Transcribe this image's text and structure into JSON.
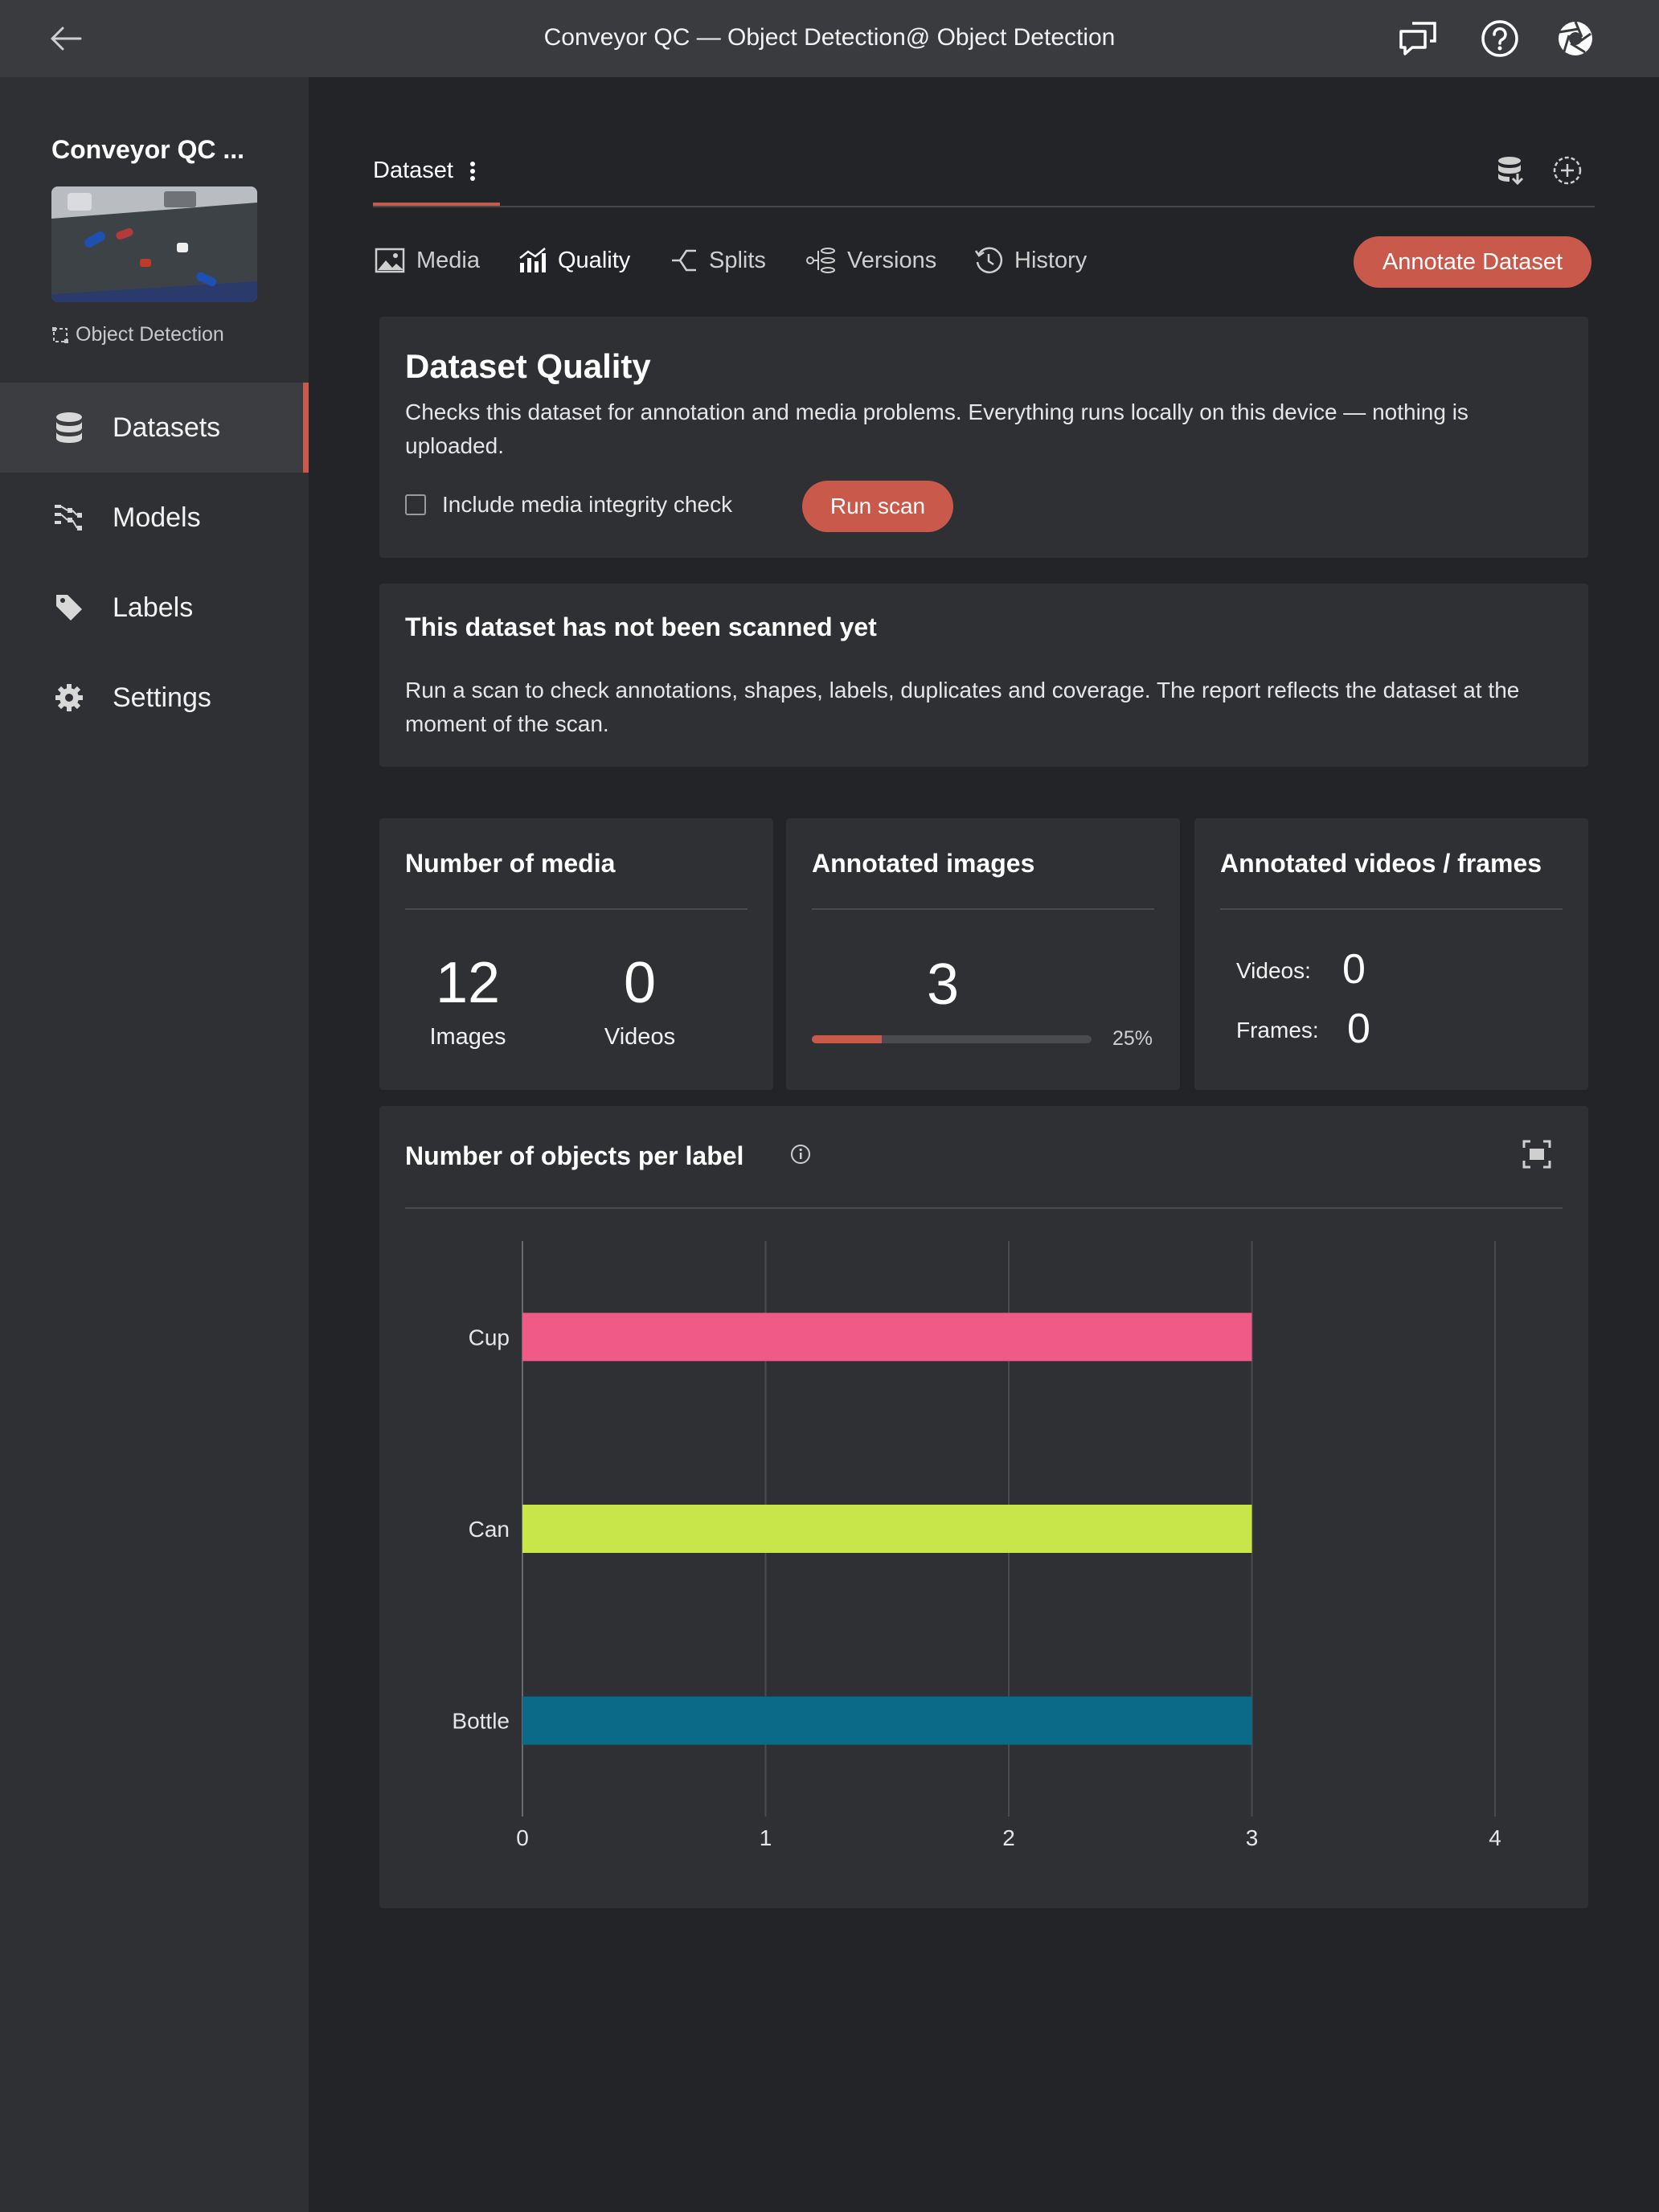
{
  "topbar": {
    "title": "Conveyor QC — Object Detection@ Object Detection",
    "icons": [
      "back-arrow-icon",
      "chat-icon",
      "help-icon",
      "aperture-icon"
    ]
  },
  "sidebar": {
    "project_name": "Conveyor QC ...",
    "task_type": "Object Detection",
    "items": [
      {
        "label": "Datasets",
        "icon": "database-icon",
        "active": true
      },
      {
        "label": "Models",
        "icon": "models-icon",
        "active": false
      },
      {
        "label": "Labels",
        "icon": "tag-icon",
        "active": false
      },
      {
        "label": "Settings",
        "icon": "gear-icon",
        "active": false
      }
    ]
  },
  "header": {
    "dataset_tab": "Dataset",
    "icons": [
      "dataset-export-icon",
      "add-dataset-icon"
    ]
  },
  "subtabs": [
    {
      "label": "Media",
      "icon": "image-icon",
      "active": false
    },
    {
      "label": "Quality",
      "icon": "chart-icon",
      "active": true
    },
    {
      "label": "Splits",
      "icon": "splits-icon",
      "active": false
    },
    {
      "label": "Versions",
      "icon": "versions-icon",
      "active": false
    },
    {
      "label": "History",
      "icon": "history-icon",
      "active": false
    }
  ],
  "annotate_button": "Annotate Dataset",
  "quality": {
    "title": "Dataset Quality",
    "description": "Checks this dataset for annotation and media problems. Everything runs locally on this device — nothing is uploaded.",
    "checkbox_label": "Include media integrity check",
    "checkbox_checked": false,
    "run_button": "Run scan"
  },
  "not_scanned": {
    "title": "This dataset has not been scanned yet",
    "description": "Run a scan to check annotations, shapes, labels, duplicates and coverage. The report reflects the dataset at the moment of the scan."
  },
  "media_card": {
    "title": "Number of media",
    "images_value": "12",
    "images_label": "Images",
    "videos_value": "0",
    "videos_label": "Videos"
  },
  "annotated_images_card": {
    "title": "Annotated images",
    "value": "3",
    "progress": 0.25,
    "progress_label": "25%"
  },
  "annotated_videos_card": {
    "title": "Annotated videos / frames",
    "videos_label": "Videos:",
    "videos_value": "0",
    "frames_label": "Frames:",
    "frames_value": "0"
  },
  "chart_panel": {
    "title": "Number of objects per label"
  },
  "colors": {
    "accent": "#c9594a",
    "cup": "#f05a87",
    "can": "#c8e64a",
    "bottle": "#0b6a88"
  },
  "chart_data": {
    "type": "bar",
    "orientation": "horizontal",
    "title": "Number of objects per label",
    "categories": [
      "Cup",
      "Can",
      "Bottle"
    ],
    "values": [
      3,
      3,
      3
    ],
    "colors": [
      "#f05a87",
      "#c8e64a",
      "#0b6a88"
    ],
    "xlim": [
      0,
      4
    ],
    "xticks": [
      "0",
      "1",
      "2",
      "3",
      "4"
    ],
    "grid": true
  }
}
